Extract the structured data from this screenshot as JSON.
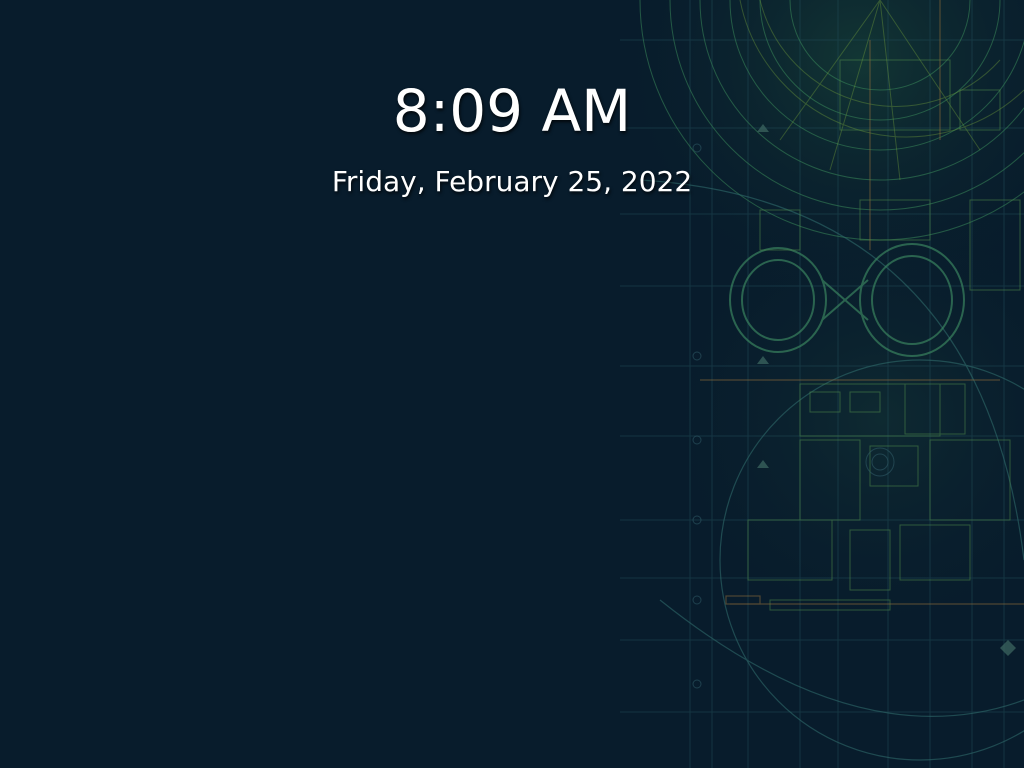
{
  "lock_screen": {
    "time": "8:09 AM",
    "date": "Friday, February 25, 2022"
  },
  "wallpaper": {
    "subject": "architectural-blueprint-floorplan",
    "background_color": "#081c2c",
    "line_colors": [
      "#2f8a5a",
      "#7fae3c",
      "#8a6a3a",
      "#3a6a7a"
    ]
  }
}
